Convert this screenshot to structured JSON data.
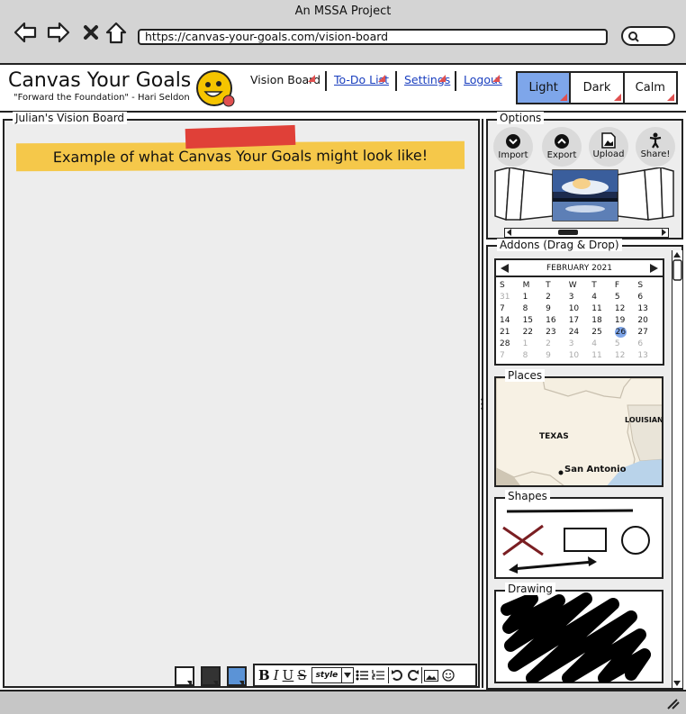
{
  "window": {
    "title": "An MSSA Project"
  },
  "browser": {
    "url": "https://canvas-your-goals.com/vision-board"
  },
  "app": {
    "title": "Canvas Your Goals",
    "quote": "\"Forward the Foundation\" - Hari Seldon",
    "nav": [
      "Vision Board",
      "To-Do List",
      "Settings",
      "Logout"
    ],
    "themes": [
      "Light",
      "Dark",
      "Calm"
    ],
    "active_theme": "Light",
    "accent": "#7ea6ea"
  },
  "board": {
    "title": "Julian's Vision Board",
    "banner": "Example of what Canvas Your Goals might look like!",
    "toolbar": {
      "bold": "B",
      "italic": "I",
      "underline": "U",
      "strike": "S",
      "style": "style"
    },
    "swatches": [
      "#ffffff",
      "#333333",
      "#5b93d6"
    ]
  },
  "options": {
    "title": "Options",
    "buttons": [
      {
        "label": "Import",
        "icon": "chevron-down-icon"
      },
      {
        "label": "Export",
        "icon": "chevron-up-icon"
      },
      {
        "label": "Upload",
        "icon": "image-icon"
      },
      {
        "label": "Share!",
        "icon": "person-icon"
      }
    ]
  },
  "addons": {
    "title": "Addons (Drag & Drop)",
    "calendar": {
      "month": "FEBRUARY 2021",
      "weekdays": [
        "S",
        "M",
        "T",
        "W",
        "T",
        "F",
        "S"
      ],
      "days": [
        {
          "d": "31",
          "dim": true
        },
        {
          "d": "1"
        },
        {
          "d": "2"
        },
        {
          "d": "3"
        },
        {
          "d": "4"
        },
        {
          "d": "5"
        },
        {
          "d": "6"
        },
        {
          "d": "7"
        },
        {
          "d": "8"
        },
        {
          "d": "9"
        },
        {
          "d": "10"
        },
        {
          "d": "11"
        },
        {
          "d": "12"
        },
        {
          "d": "13"
        },
        {
          "d": "14"
        },
        {
          "d": "15"
        },
        {
          "d": "16"
        },
        {
          "d": "17"
        },
        {
          "d": "18"
        },
        {
          "d": "19"
        },
        {
          "d": "20"
        },
        {
          "d": "21"
        },
        {
          "d": "22"
        },
        {
          "d": "23"
        },
        {
          "d": "24"
        },
        {
          "d": "25"
        },
        {
          "d": "26",
          "sel": true
        },
        {
          "d": "27"
        },
        {
          "d": "28"
        },
        {
          "d": "1",
          "dim": true
        },
        {
          "d": "2",
          "dim": true
        },
        {
          "d": "3",
          "dim": true
        },
        {
          "d": "4",
          "dim": true
        },
        {
          "d": "5",
          "dim": true
        },
        {
          "d": "6",
          "dim": true
        },
        {
          "d": "7",
          "dim": true
        },
        {
          "d": "8",
          "dim": true
        },
        {
          "d": "9",
          "dim": true
        },
        {
          "d": "10",
          "dim": true
        },
        {
          "d": "11",
          "dim": true
        },
        {
          "d": "12",
          "dim": true
        },
        {
          "d": "13",
          "dim": true
        }
      ]
    },
    "places": {
      "title": "Places",
      "labels": {
        "texas": "TEXAS",
        "louisiana": "LOUISIANA",
        "city": "San Antonio"
      }
    },
    "shapes": {
      "title": "Shapes"
    },
    "drawing": {
      "title": "Drawing"
    }
  }
}
